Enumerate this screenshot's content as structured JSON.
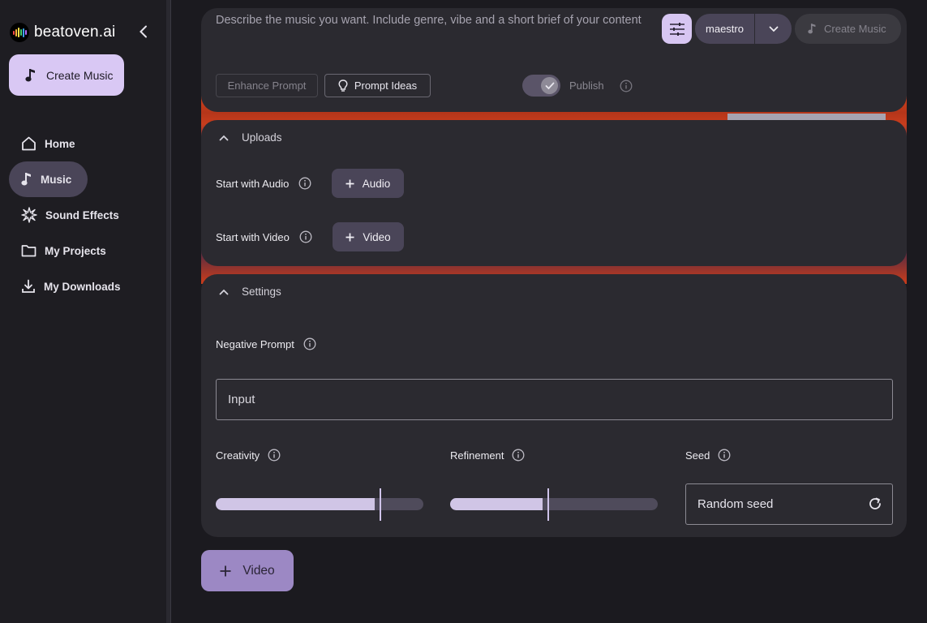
{
  "brand": {
    "name": "beatoven.ai"
  },
  "sidebar": {
    "create_label": "Create Music",
    "items": [
      {
        "label": "Home",
        "icon": "home-icon"
      },
      {
        "label": "Music",
        "icon": "music-note-icon",
        "active": true
      },
      {
        "label": "Sound Effects",
        "icon": "burst-icon"
      },
      {
        "label": "My Projects",
        "icon": "folder-icon"
      },
      {
        "label": "My Downloads",
        "icon": "download-icon"
      }
    ]
  },
  "prompt": {
    "placeholder": "Describe the music you want. Include genre, vibe and a short brief of your content",
    "model": "maestro",
    "create_label": "Create Music",
    "enhance_label": "Enhance Prompt",
    "ideas_label": "Prompt Ideas",
    "publish_label": "Publish",
    "publish_on": true
  },
  "uploads": {
    "title": "Uploads",
    "audio_label": "Start with Audio",
    "audio_button": "Audio",
    "video_label": "Start with Video",
    "video_button": "Video"
  },
  "settings": {
    "title": "Settings",
    "negative_label": "Negative Prompt",
    "negative_placeholder": "Input",
    "creativity_label": "Creativity",
    "creativity_value": 0.79,
    "refinement_label": "Refinement",
    "refinement_value": 0.47,
    "seed_label": "Seed",
    "seed_placeholder": "Random seed"
  },
  "bottom": {
    "video_button": "Video"
  },
  "colors": {
    "accent": "#d9c8f4",
    "panel": "#2b2a30",
    "chip": "#4a4558"
  }
}
